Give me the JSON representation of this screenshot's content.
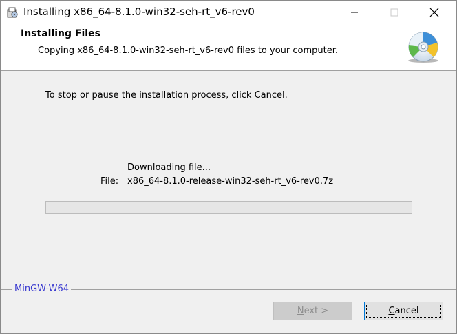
{
  "window": {
    "title": "Installing x86_64-8.1.0-win32-seh-rt_v6-rev0"
  },
  "header": {
    "title": "Installing Files",
    "subtitle": "Copying x86_64-8.1.0-win32-seh-rt_v6-rev0 files to your computer."
  },
  "body": {
    "instruction": "To stop or pause the installation process, click Cancel.",
    "status": "Downloading file...",
    "file_label": "File:",
    "file_name": "x86_64-8.1.0-release-win32-seh-rt_v6-rev0.7z",
    "progress_fraction": 0
  },
  "footer": {
    "branding": "MinGW-W64",
    "next_label": "Next >",
    "cancel_label": "Cancel"
  },
  "colors": {
    "branding": "#3a3ad0",
    "cancel_focus_border": "#0078d7",
    "disabled_button_bg": "#cccccc"
  }
}
